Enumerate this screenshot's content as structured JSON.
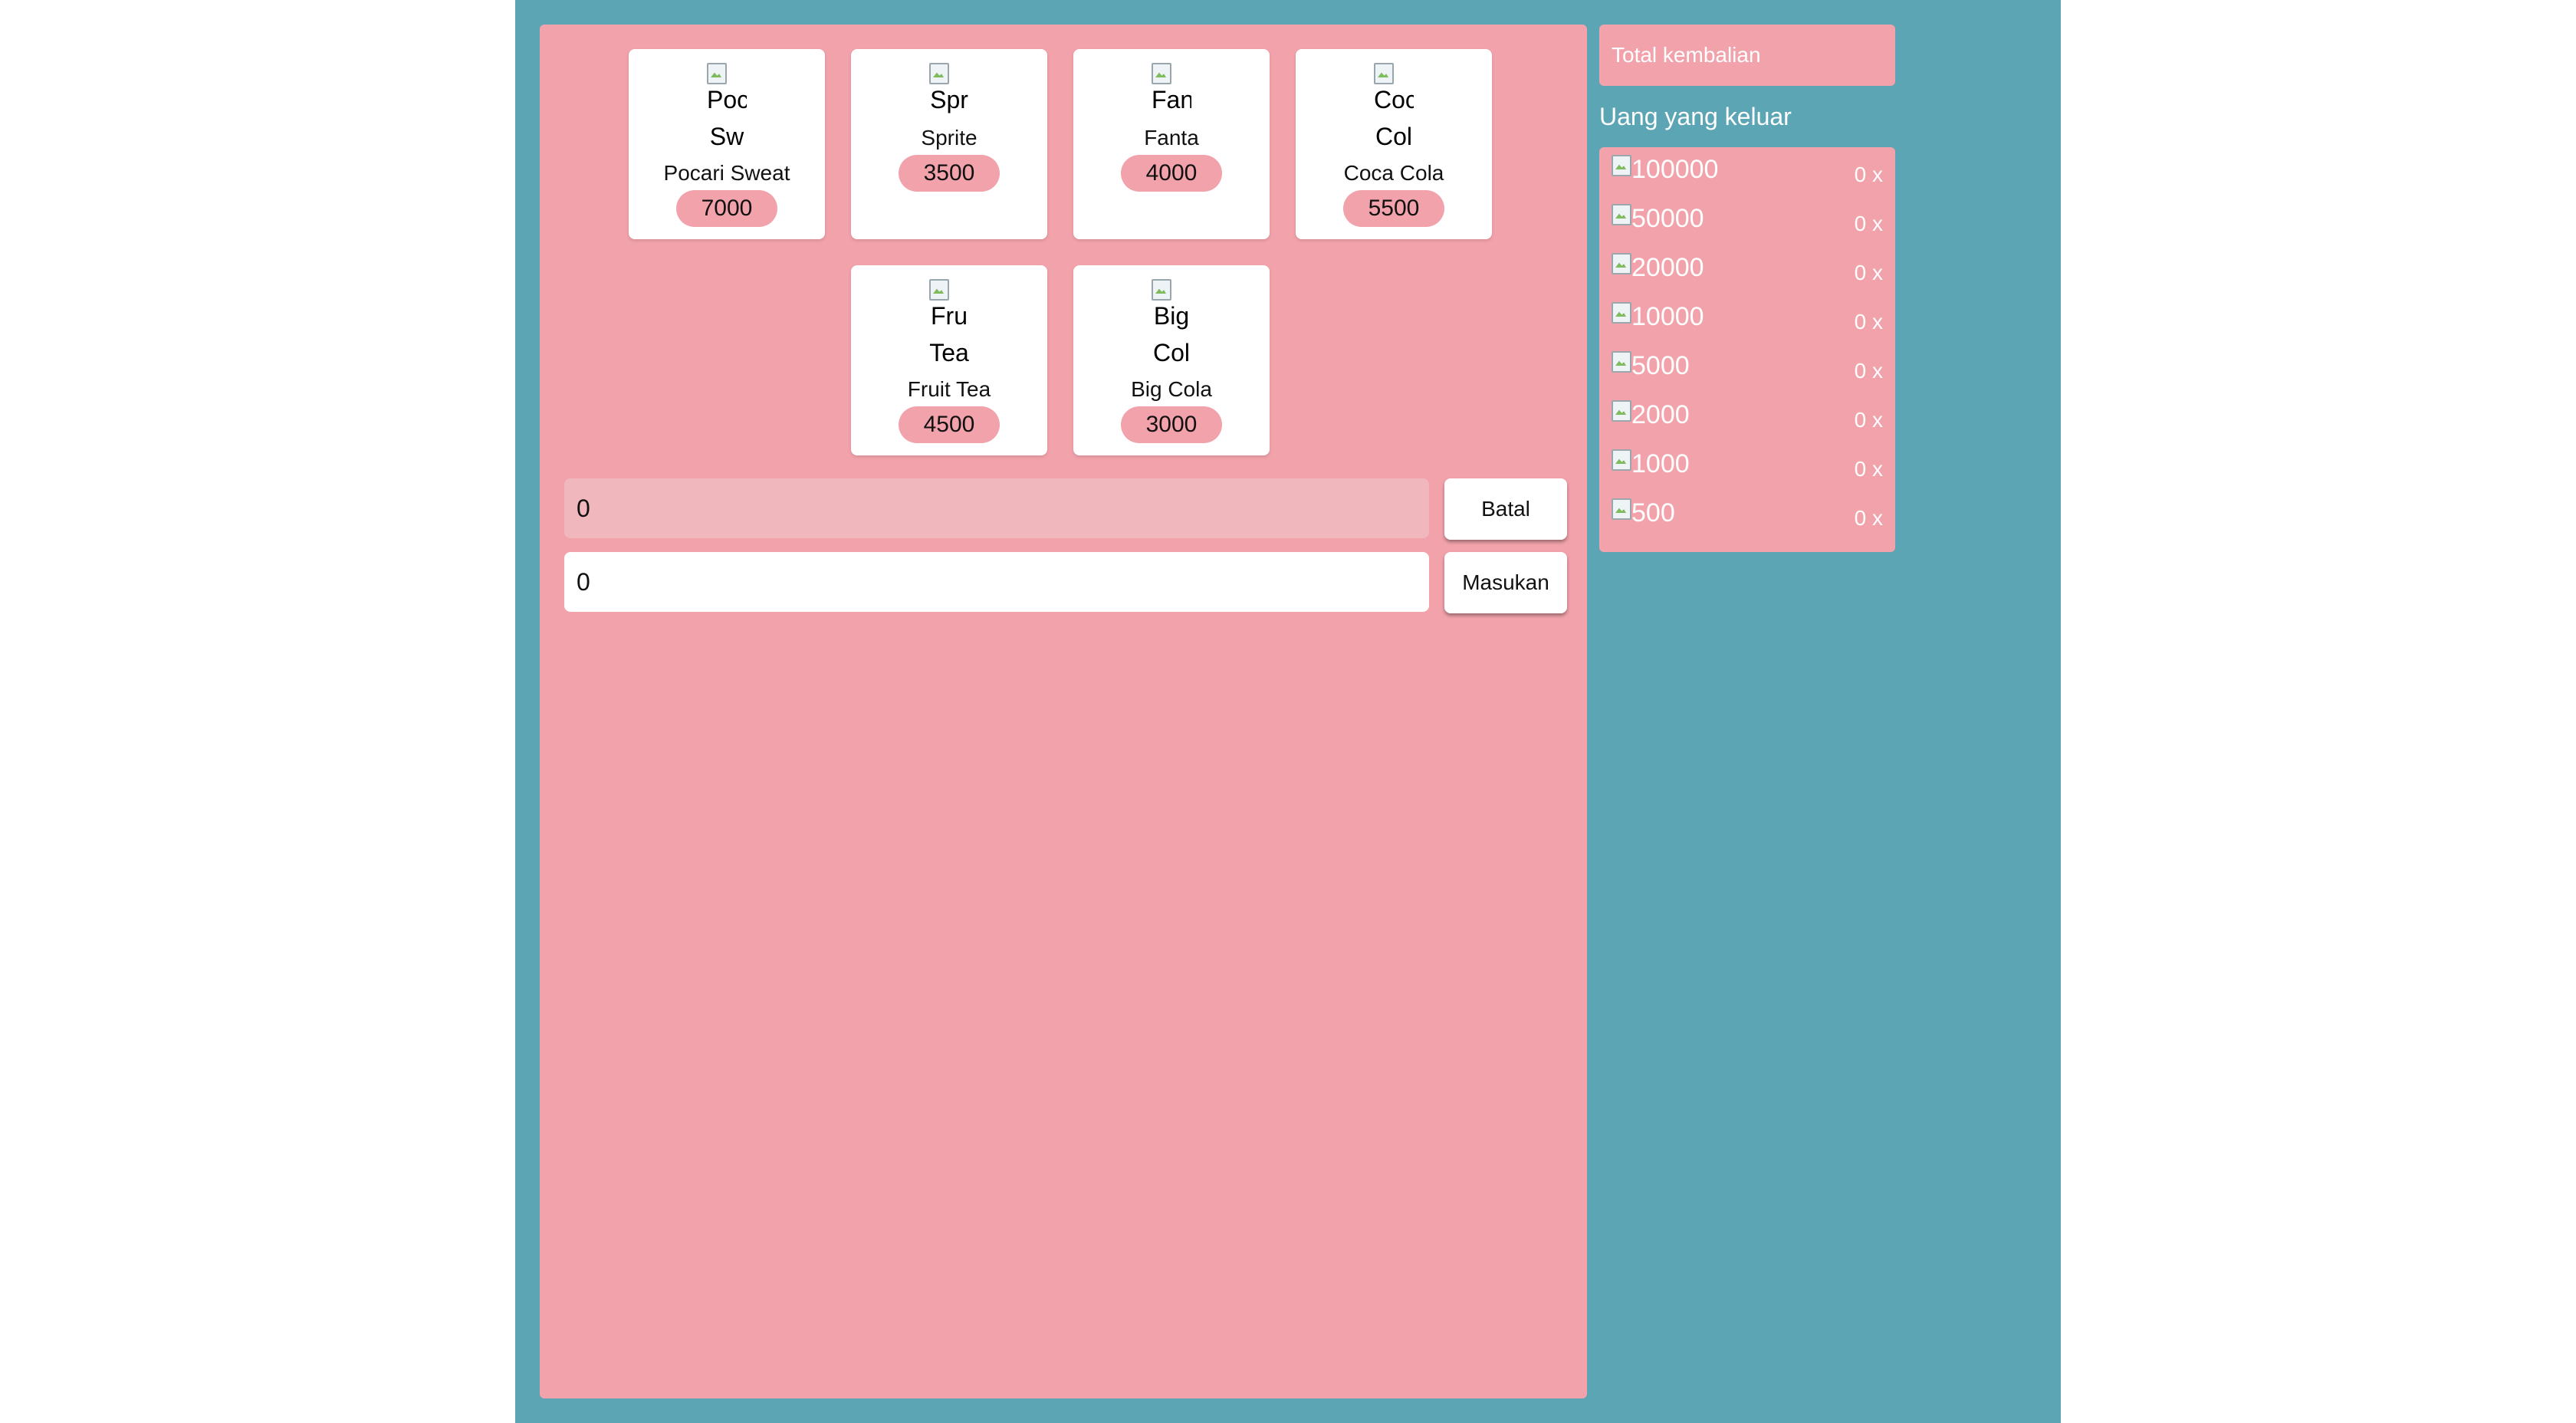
{
  "colors": {
    "frame": "#5ca5b5",
    "panel": "#f2a2aa",
    "display_field": "#f0b8bd",
    "card": "#ffffff"
  },
  "products": [
    {
      "img_alt_lines": [
        "Poc",
        "Sw"
      ],
      "name": "Pocari Sweat",
      "price": "7000"
    },
    {
      "img_alt_lines": [
        "Spr"
      ],
      "name": "Sprite",
      "price": "3500"
    },
    {
      "img_alt_lines": [
        "Fan"
      ],
      "name": "Fanta",
      "price": "4000"
    },
    {
      "img_alt_lines": [
        "Coc",
        "Col"
      ],
      "name": "Coca Cola",
      "price": "5500"
    },
    {
      "img_alt_lines": [
        "Fru",
        "Tea"
      ],
      "name": "Fruit Tea",
      "price": "4500"
    },
    {
      "img_alt_lines": [
        "Big",
        "Col"
      ],
      "name": "Big Cola",
      "price": "3000"
    }
  ],
  "display_value": "0",
  "input_value": "0",
  "buttons": {
    "cancel": "Batal",
    "insert": "Masukan"
  },
  "sidebar": {
    "total_label": "Total kembalian",
    "output_title": "Uang yang keluar",
    "denominations": [
      {
        "value": "100000",
        "count": "0 x"
      },
      {
        "value": "50000",
        "count": "0 x"
      },
      {
        "value": "20000",
        "count": "0 x"
      },
      {
        "value": "10000",
        "count": "0 x"
      },
      {
        "value": "5000",
        "count": "0 x"
      },
      {
        "value": "2000",
        "count": "0 x"
      },
      {
        "value": "1000",
        "count": "0 x"
      },
      {
        "value": "500",
        "count": "0 x"
      }
    ]
  }
}
